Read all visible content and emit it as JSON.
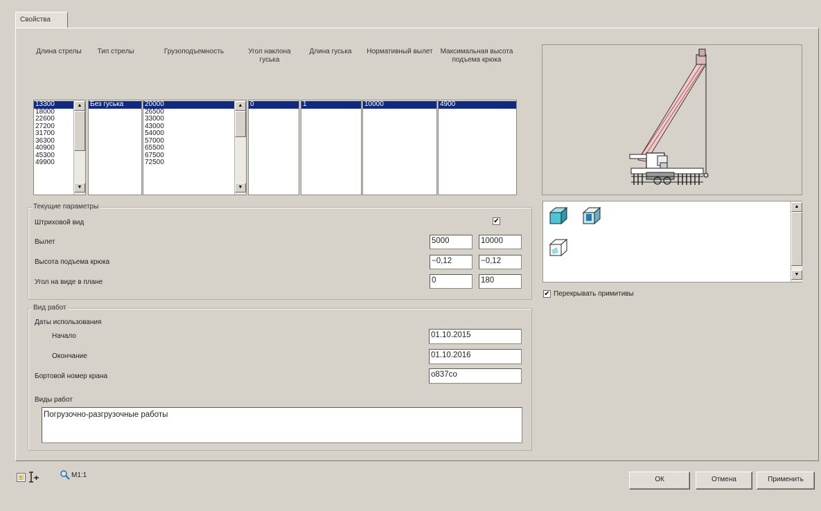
{
  "tab": {
    "label": "Свойства"
  },
  "columns": {
    "boom_length": "Длина стрелы",
    "boom_type": "Тип стрелы",
    "capacity": "Грузоподъемность",
    "jib_angle": "Угол наклона гуська",
    "jib_length": "Длина гуська",
    "normative_reach": "Нормативный вылет",
    "max_hook_height": "Максимальная высота подъема крюка"
  },
  "lists": {
    "boom_length": [
      "13300",
      "18000",
      "22600",
      "27200",
      "31700",
      "36300",
      "40900",
      "45300",
      "49900"
    ],
    "boom_type": [
      "Без гуська"
    ],
    "capacity": [
      "20000",
      "26500",
      "33000",
      "43000",
      "54000",
      "57000",
      "65500",
      "67500",
      "72500"
    ],
    "jib_angle": [
      "0"
    ],
    "jib_length": [
      "1"
    ],
    "normative_reach": [
      "10000"
    ],
    "max_hook_height": [
      "4900"
    ]
  },
  "current_params": {
    "title": "Текущие параметры",
    "hatch_view_label": "Штриховой вид",
    "hatch_view_checked": true,
    "reach_label": "Вылет",
    "reach_min": "5000",
    "reach_max": "10000",
    "hook_height_label": "Высота подъема крюка",
    "hook_height_min": "−0,12",
    "hook_height_max": "−0,12",
    "plan_angle_label": "Угол на виде в плане",
    "plan_angle_min": "0",
    "plan_angle_max": "180"
  },
  "work_type": {
    "title": "Вид работ",
    "dates_label": "Даты использования",
    "start_label": "Начало",
    "start_value": "01.10.2015",
    "end_label": "Окончание",
    "end_value": "01.10.2016",
    "crane_number_label": "Бортовой номер крана",
    "crane_number_value": "о837со",
    "work_kinds_label": "Виды работ",
    "work_kinds_value": "Погрузочно-разгрузочные работы"
  },
  "view_options": {
    "overlap_primitives_label": "Перекрывать примитивы",
    "overlap_primitives_checked": true,
    "icons": [
      "cube-solid-icon",
      "cube-shaded-icon",
      "cube-wireframe-icon"
    ]
  },
  "footer": {
    "scale_label": "M1:1",
    "ok_label": "ОК",
    "cancel_label": "Отмена",
    "apply_label": "Применить"
  },
  "colors": {
    "selection": "#102a82",
    "boom": "#f2c9c9",
    "cube_fill": "#4cc4d4"
  }
}
